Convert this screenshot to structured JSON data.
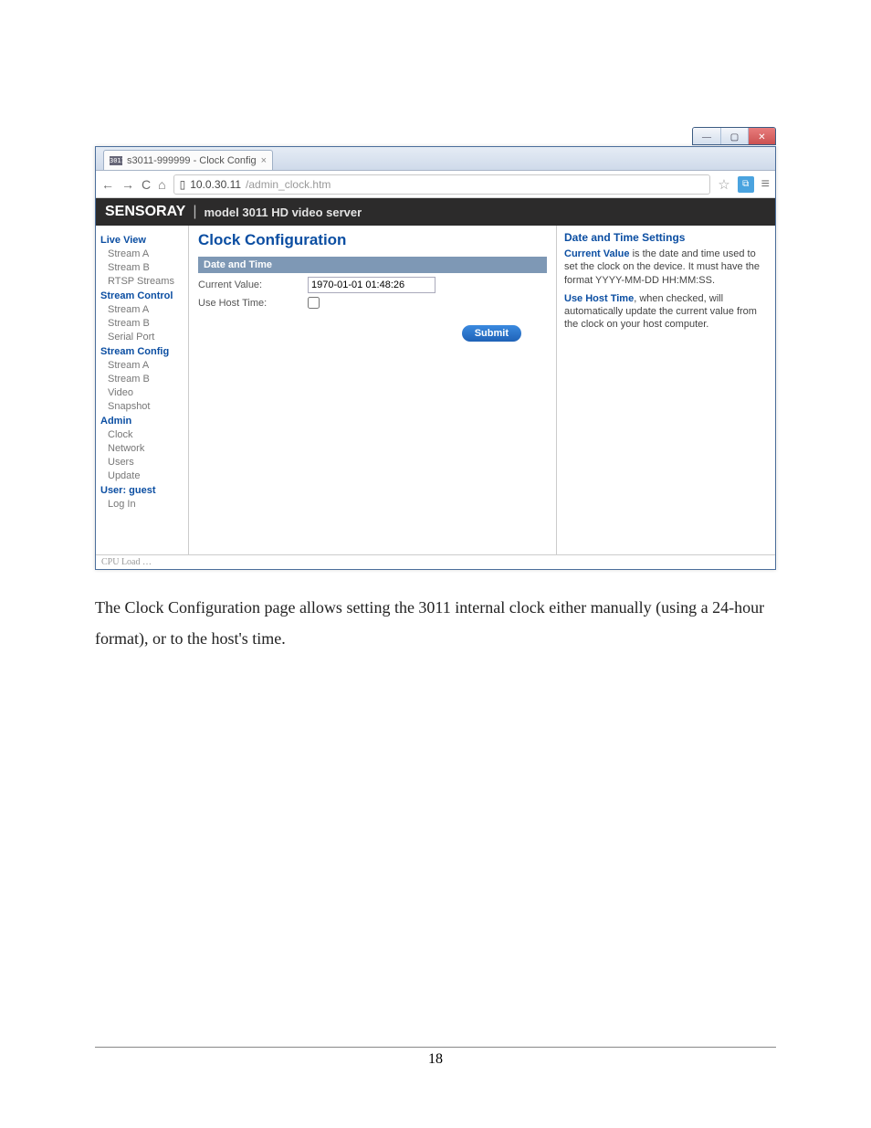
{
  "titlebar": {
    "min": "—",
    "max": "▢",
    "close": "✕"
  },
  "tab": {
    "favicon": "3011",
    "title": "s3011-999999 - Clock Config",
    "close": "×"
  },
  "toolbar": {
    "back": "←",
    "forward": "→",
    "reload": "C",
    "home": "⌂",
    "url_host": "10.0.30.11",
    "url_path": "/admin_clock.htm",
    "star": "☆",
    "menu": "≡"
  },
  "banner": {
    "brand": "SENSORAY",
    "sep": "|",
    "subtitle": "model 3011 HD video server"
  },
  "sidebar": {
    "groups": [
      {
        "head": "Live View",
        "items": [
          "Stream A",
          "Stream B",
          "RTSP Streams"
        ]
      },
      {
        "head": "Stream Control",
        "items": [
          "Stream A",
          "Stream B",
          "Serial Port"
        ]
      },
      {
        "head": "Stream Config",
        "items": [
          "Stream A",
          "Stream B",
          "Video",
          "Snapshot"
        ]
      },
      {
        "head": "Admin",
        "items": [
          "Clock",
          "Network",
          "Users",
          "Update"
        ]
      },
      {
        "head": "User: guest",
        "items": [
          "Log In"
        ]
      }
    ]
  },
  "main": {
    "title": "Clock Configuration",
    "section": "Date and Time",
    "current_label": "Current Value:",
    "current_value": "1970-01-01 01:48:26",
    "usehost_label": "Use Host Time:",
    "submit": "Submit"
  },
  "help": {
    "title": "Date and Time Settings",
    "p1_bold": "Current Value",
    "p1_rest": " is the date and time used to set the clock on the device. It must have the format YYYY-MM-DD HH:MM:SS.",
    "p2_bold": "Use Host Time",
    "p2_rest": ", when checked, will automatically update the current value from the clock on your host computer."
  },
  "status": "CPU Load …",
  "doc_paragraph": "The Clock Configuration page allows setting the 3011 internal clock either manually (using a 24-hour format), or to the host's time.",
  "page_number": "18"
}
